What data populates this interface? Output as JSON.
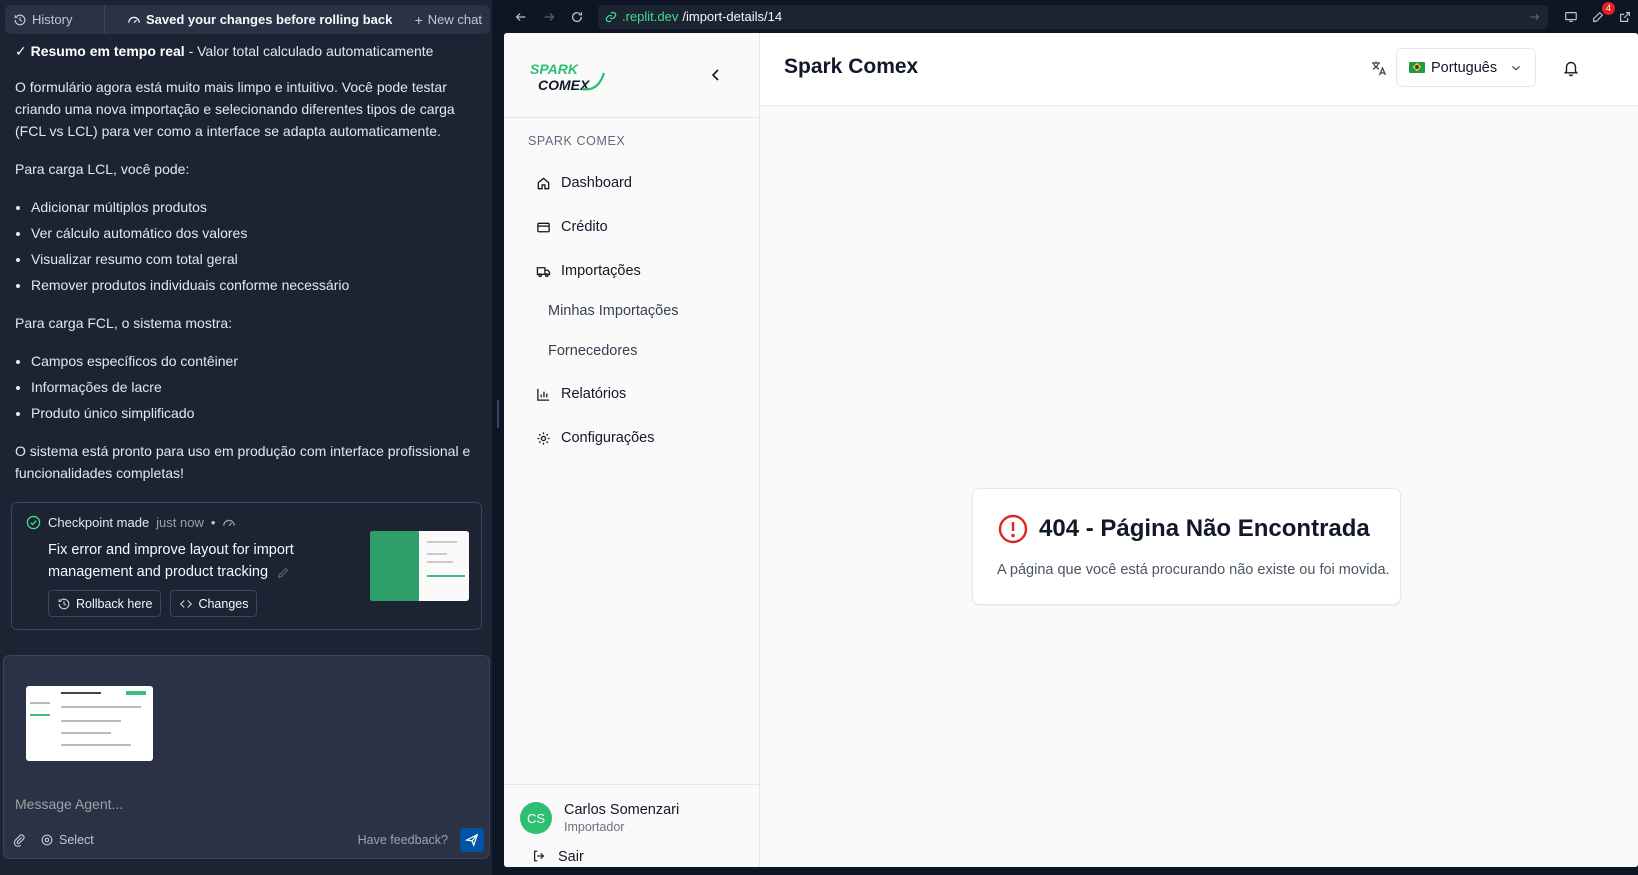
{
  "agent": {
    "top_bar": {
      "history": "History",
      "saved_status": "Saved your changes before rolling back",
      "new_chat": "New chat"
    },
    "messages": {
      "resumo_bold": "Resumo em tempo real",
      "resumo_rest": " - Valor total calculado automaticamente",
      "resumo_check": "✓ ",
      "p1": "O formulário agora está muito mais limpo e intuitivo. Você pode testar criando uma nova importação e selecionando diferentes tipos de carga (FCL vs LCL) para ver como a interface se adapta automaticamente.",
      "p2": "Para carga LCL, você pode:",
      "lcl_items": [
        "Adicionar múltiplos produtos",
        "Ver cálculo automático dos valores",
        "Visualizar resumo com total geral",
        "Remover produtos individuais conforme necessário"
      ],
      "p3": "Para carga FCL, o sistema mostra:",
      "fcl_items": [
        "Campos específicos do contêiner",
        "Informações de lacre",
        "Produto único simplificado"
      ],
      "p4": "O sistema está pronto para uso em produção com interface profissional e funcionalidades completas!"
    },
    "checkpoint": {
      "label": "Checkpoint made",
      "when": "just now",
      "dot": "•",
      "title": "Fix error and improve layout for import management and product tracking",
      "rollback": "Rollback here",
      "changes": "Changes"
    },
    "composer": {
      "placeholder": "Message Agent...",
      "select": "Select",
      "feedback": "Have feedback?"
    }
  },
  "browser": {
    "url_domain": ".replit.dev",
    "url_path": "/import-details/14",
    "badge_count": "4"
  },
  "app": {
    "sidebar": {
      "group_label": "SPARK COMEX",
      "items": [
        {
          "label": "Dashboard",
          "icon": "home-icon"
        },
        {
          "label": "Crédito",
          "icon": "credit-card-icon"
        },
        {
          "label": "Importações",
          "icon": "truck-icon"
        },
        {
          "label": "Relatórios",
          "icon": "bar-chart-icon"
        },
        {
          "label": "Configurações",
          "icon": "gear-icon"
        }
      ],
      "sub_items": [
        "Minhas Importações",
        "Fornecedores"
      ],
      "user": {
        "initials": "CS",
        "name": "Carlos Somenzari",
        "role": "Importador"
      },
      "logout": "Sair"
    },
    "header": {
      "title": "Spark Comex",
      "language": "Português"
    },
    "not_found": {
      "title": "404 - Página Não Encontrada",
      "message": "A página que você está procurando não existe ou foi movida."
    }
  },
  "colors": {
    "brand_green": "#2fbf71",
    "error_red": "#dc2626",
    "agent_bg": "#1c2333",
    "send_blue": "#0053a6"
  }
}
